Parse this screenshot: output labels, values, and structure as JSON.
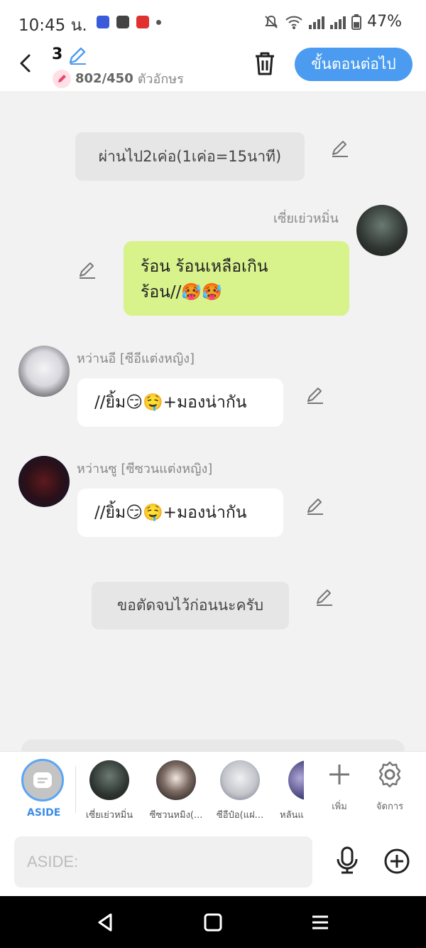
{
  "status": {
    "time": "10:45 น.",
    "battery": "47%"
  },
  "header": {
    "title_number": "3",
    "char_count": "802/450",
    "char_unit": "ตัวอักษร",
    "next_label": "ขั้นตอนต่อไป"
  },
  "messages": [
    {
      "type": "narration",
      "text": "ผ่านไป2เค่อ(1เค่อ=15นาที)"
    },
    {
      "type": "message",
      "side": "right",
      "name": "เซี่ยเย่วหมิ่น",
      "text_line1": "ร้อน ร้อนเหลือเกิน",
      "text_line2": "ร้อน//🥵🥵"
    },
    {
      "type": "message",
      "side": "left",
      "name": "หว่านอี [ซีอีแต่งหญิง]",
      "text": "//ยิ้ม😏🤤+มองน่ากัน"
    },
    {
      "type": "message",
      "side": "left",
      "name": "หว่านซู [ซีซวนแต่งหญิง]",
      "text": "//ยิ้ม😏🤤+มองน่ากัน"
    },
    {
      "type": "narration",
      "text": "ขอตัดจบไว้ก่อนนะครับ"
    }
  ],
  "characters": {
    "aside_label": "ASIDE",
    "items": [
      {
        "label": "เซี่ยเย่วหมิ่น"
      },
      {
        "label": "ซีซวนหมิง(..."
      },
      {
        "label": "ซีอีป๋อ(แฝ..."
      },
      {
        "label": "หลันแ"
      }
    ],
    "add_label": "เพิ่ม",
    "manage_label": "จัดการ"
  },
  "input": {
    "placeholder": "ASIDE:"
  },
  "colors": {
    "accent": "#4b9cf0",
    "bubble_green": "#d8f28c",
    "narration_bg": "#e6e6e6"
  }
}
